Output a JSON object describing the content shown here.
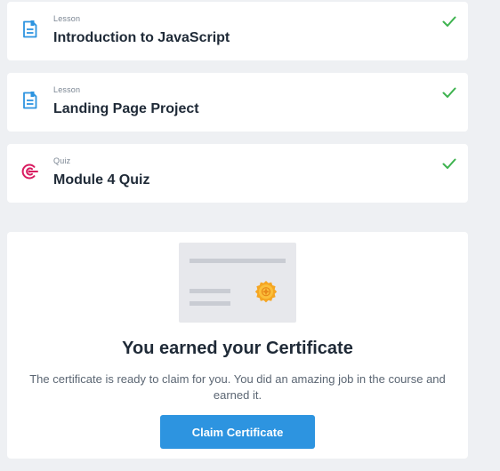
{
  "curriculum": {
    "items": [
      {
        "type": "Lesson",
        "title": "Introduction to JavaScript",
        "icon": "lesson-document-icon",
        "status_icon": "check-icon"
      },
      {
        "type": "Lesson",
        "title": "Landing Page Project",
        "icon": "lesson-document-icon",
        "status_icon": "check-icon"
      },
      {
        "type": "Quiz",
        "title": "Module 4 Quiz",
        "icon": "quiz-target-icon",
        "status_icon": "check-icon"
      }
    ]
  },
  "certificate": {
    "heading": "You earned your Certificate",
    "description": "The certificate is ready to claim for you. You did an amazing job in the course and earned it.",
    "button_label": "Claim Certificate",
    "illustration_icon": "certificate-icon"
  },
  "colors": {
    "accent": "#2d94e0",
    "success": "#3eb34f",
    "quiz": "#d81b60",
    "lesson_icon": "#2d94e0",
    "background": "#eef0f3"
  }
}
